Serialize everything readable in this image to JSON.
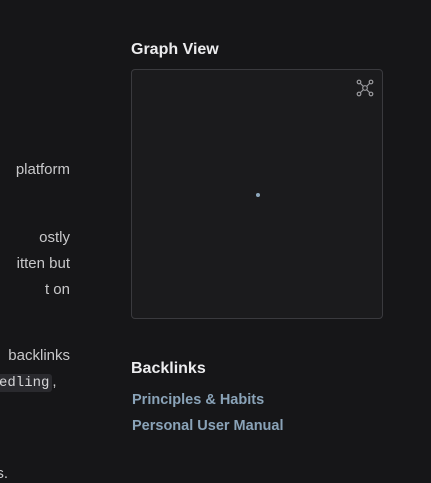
{
  "main_text": {
    "fragments": [
      "platform",
      "ostly",
      "itten but",
      "t on",
      "backlinks",
      ",",
      "s."
    ],
    "code_text": "edling"
  },
  "graph": {
    "title": "Graph View",
    "toggle_icon": "graph-network-icon",
    "node_count": 1,
    "node_color": "#8ea8bd"
  },
  "backlinks": {
    "title": "Backlinks",
    "items": [
      {
        "label": "Principles & Habits"
      },
      {
        "label": "Personal User Manual"
      }
    ],
    "link_color": "#8aa3b8"
  },
  "colors": {
    "background": "#161618",
    "panel_border": "#3a3a3e",
    "heading": "#ececee"
  }
}
